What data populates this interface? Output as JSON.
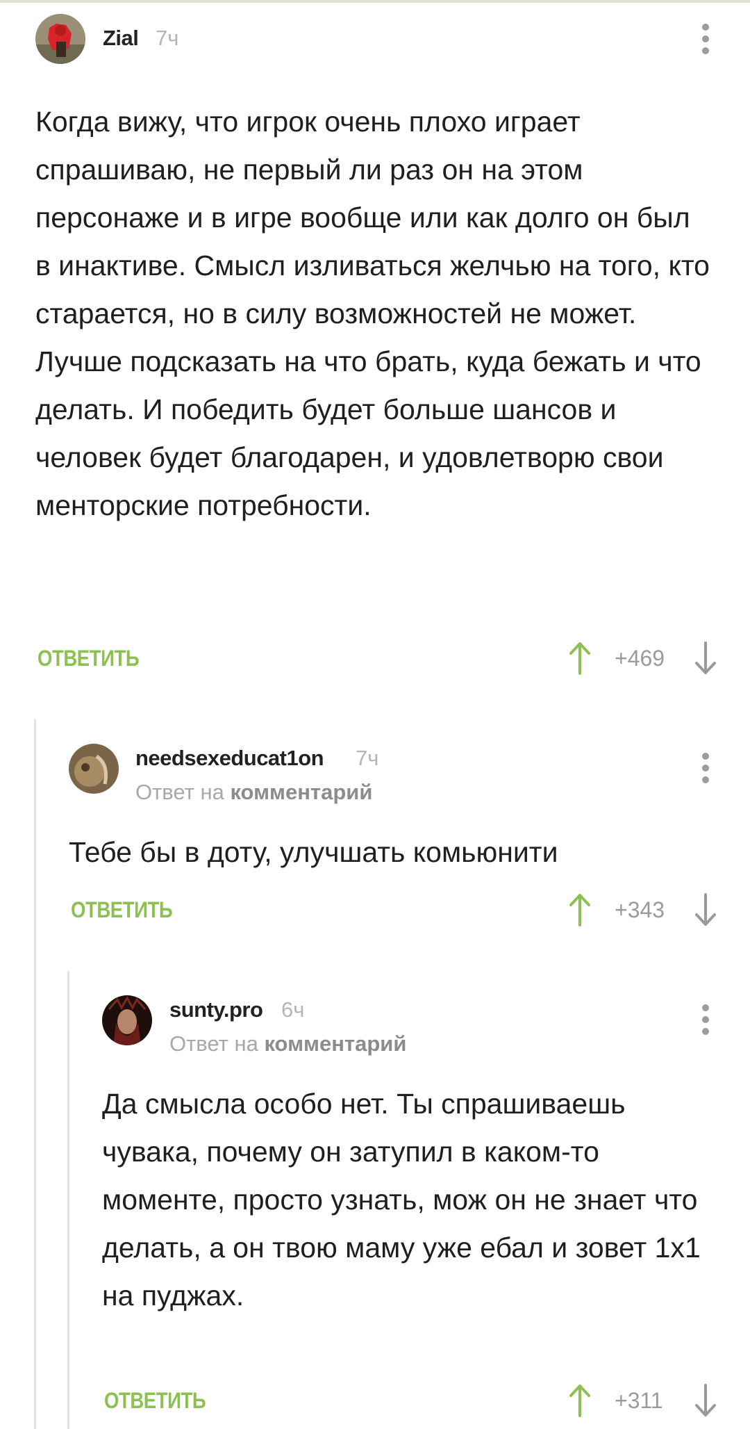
{
  "comments": [
    {
      "username": "Zial",
      "time": "7ч",
      "text": "Когда вижу, что игрок очень плохо играет спрашиваю, не первый ли раз он на этом персонаже и в игре вообще или как долго он был в инактиве. Смысл изливаться желчью на того, кто старается, но в силу возможностей не может. Лучше подсказать на что брать, куда бежать и что делать. И победить будет больше шансов и человек будет благодарен, и удовлетворю свои менторские потребности.",
      "reply_label": "ОТВЕТИТЬ",
      "rating": "+469"
    },
    {
      "username": "needsexeducat1on",
      "time": "7ч",
      "reply_prefix": "Ответ на",
      "reply_target": "комментарий",
      "text": "Тебе бы в доту, улучшать комьюнити",
      "reply_label": "ОТВЕТИТЬ",
      "rating": "+343"
    },
    {
      "username": "sunty.pro",
      "time": "6ч",
      "reply_prefix": "Ответ на",
      "reply_target": "комментарий",
      "text": "Да смысла особо нет. Ты спрашиваешь чувака, почему он затупил в каком-то моменте, просто узнать, мож он не знает что делать, а он твою маму уже ебал и зовет 1х1 на пуджах.",
      "reply_label": "ОТВЕТИТЬ",
      "rating": "+311"
    }
  ],
  "colors": {
    "accent": "#8cc152",
    "upvote": "#8cc152",
    "downvote": "#9a9a9a",
    "thread_line": "#e3e3e3"
  },
  "icons": [
    "kebab-menu-icon",
    "upvote-arrow-icon",
    "downvote-arrow-icon"
  ]
}
